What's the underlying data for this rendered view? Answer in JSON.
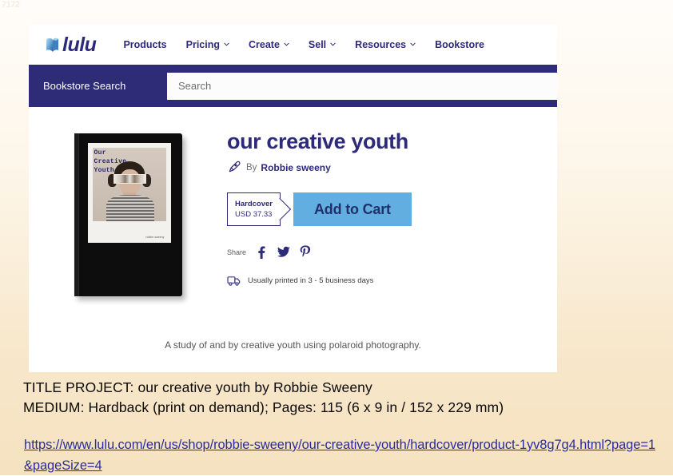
{
  "artifact": {
    "text": "7172"
  },
  "site": {
    "logo_word": "lulu",
    "logo_icon": "open-book-icon",
    "nav": [
      {
        "label": "Products",
        "has_caret": false
      },
      {
        "label": "Pricing",
        "has_caret": true
      },
      {
        "label": "Create",
        "has_caret": true
      },
      {
        "label": "Sell",
        "has_caret": true
      },
      {
        "label": "Resources",
        "has_caret": true
      },
      {
        "label": "Bookstore",
        "has_caret": false
      }
    ],
    "search": {
      "label": "Bookstore Search",
      "placeholder": "Search",
      "value": ""
    },
    "colors": {
      "brand_navy": "#2d2a7a",
      "search_band": "#2e2c77",
      "cart_blue": "#62aee0"
    }
  },
  "product": {
    "cover": {
      "title_lines": "Our\nCreative\nYouth",
      "photo_credit": "robbie sweeny",
      "background": "#0d0d0d"
    },
    "title": "our creative youth",
    "by_word": "By",
    "author": "Robbie sweeny",
    "format": {
      "name": "Hardcover",
      "price": "USD 37.33"
    },
    "add_to_cart": "Add to Cart",
    "share": {
      "label": "Share",
      "networks": [
        "facebook-icon",
        "twitter-icon",
        "pinterest-icon"
      ]
    },
    "shipping": "Usually printed in 3 - 5 business days",
    "description": "A study of and by creative youth using polaroid photography."
  },
  "caption": {
    "line1": "TITLE PROJECT:  our creative youth by Robbie Sweeny",
    "line2": "MEDIUM: Hardback (print on demand); Pages: 115 (6 x 9 in / 152 x 229 mm)"
  },
  "link": {
    "url": "https://www.lulu.com/en/us/shop/robbie-sweeny/our-creative-youth/hardcover/product-1yv8g7g4.html?page=1&pageSize=4"
  }
}
